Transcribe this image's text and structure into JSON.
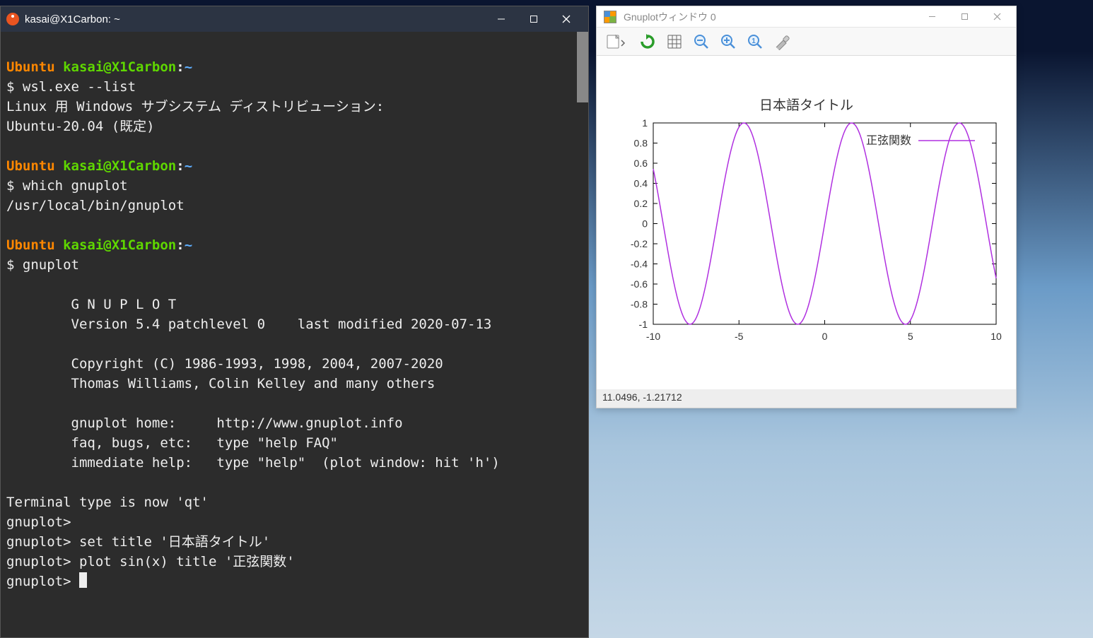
{
  "terminal": {
    "title": "kasai@X1Carbon: ~",
    "prompt_os": "Ubuntu",
    "prompt_user": "kasai@X1Carbon",
    "prompt_path": "~",
    "lines": {
      "l1_cmd": "$ wsl.exe --list",
      "l2": "Linux 用 Windows サブシステム ディストリビューション:",
      "l3": "Ubuntu-20.04 (既定)",
      "l4_cmd": "$ which gnuplot",
      "l5": "/usr/local/bin/gnuplot",
      "l6_cmd": "$ gnuplot",
      "banner1": "        G N U P L O T",
      "banner2": "        Version 5.4 patchlevel 0    last modified 2020-07-13",
      "banner3": "        Copyright (C) 1986-1993, 1998, 2004, 2007-2020",
      "banner4": "        Thomas Williams, Colin Kelley and many others",
      "banner5": "        gnuplot home:     http://www.gnuplot.info",
      "banner6": "        faq, bugs, etc:   type \"help FAQ\"",
      "banner7": "        immediate help:   type \"help\"  (plot window: hit 'h')",
      "term": "Terminal type is now 'qt'",
      "gp1": "gnuplot>",
      "gp2": "gnuplot> set title '日本語タイトル'",
      "gp3": "gnuplot> plot sin(x) title '正弦関数'",
      "gp4": "gnuplot> "
    }
  },
  "gnuplot": {
    "title": "Gnuplotウィンドウ 0",
    "status": "11.0496, -1.21712",
    "toolbar": {
      "export": "export-icon",
      "reload": "reload-icon",
      "grid": "grid-icon",
      "zoom_out": "zoom-out-icon",
      "zoom_in": "zoom-in-icon",
      "zoom_reset": "zoom-reset-icon",
      "settings": "settings-icon"
    }
  },
  "chart_data": {
    "type": "line",
    "title": "日本語タイトル",
    "legend": "正弦関数",
    "xlabel": "",
    "ylabel": "",
    "xlim": [
      -10,
      10
    ],
    "ylim": [
      -1,
      1
    ],
    "xticks": [
      -10,
      -5,
      0,
      5,
      10
    ],
    "yticks": [
      -1,
      -0.8,
      -0.6,
      -0.4,
      -0.2,
      0,
      0.2,
      0.4,
      0.6,
      0.8,
      1
    ],
    "series": [
      {
        "name": "正弦関数",
        "function": "sin(x)",
        "color": "#b030e0"
      }
    ]
  }
}
